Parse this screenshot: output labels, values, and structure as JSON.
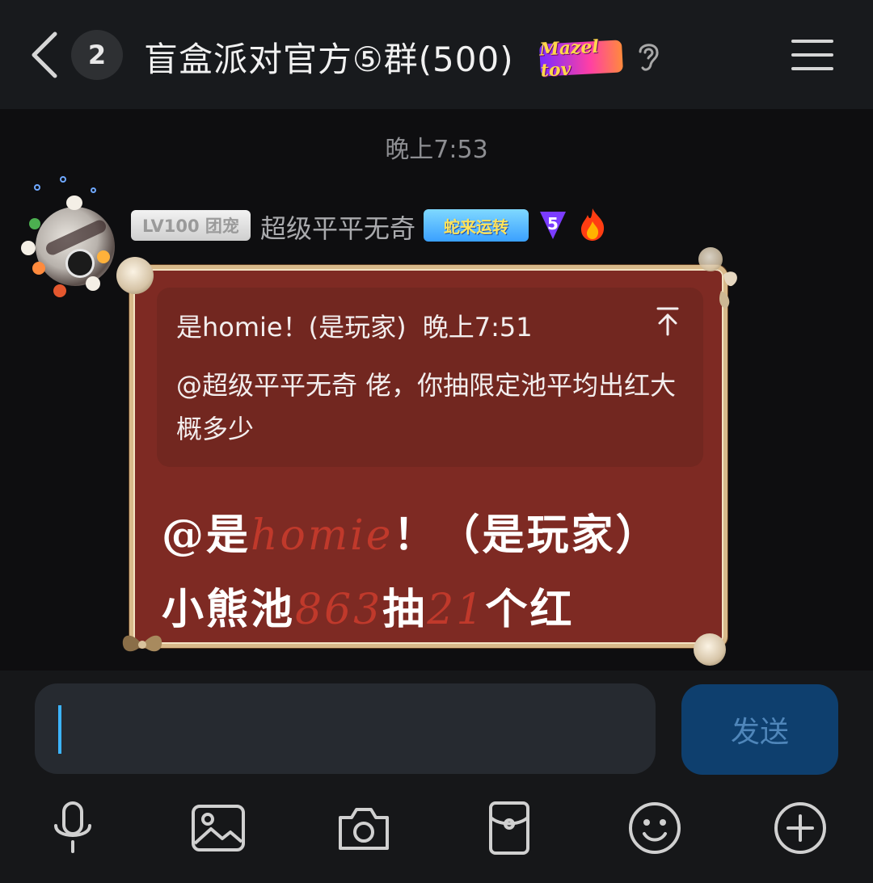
{
  "header": {
    "unread_count": "2",
    "group_title": "盲盒派对官方⑤群(500)",
    "tag_badge": "Mazel tov"
  },
  "time_divider": "晚上7:53",
  "message": {
    "level_badge": "LV100 团宠",
    "sender_name": "超级平平无奇",
    "title_badge": "蛇来运转",
    "quote": {
      "author": "是homie！(是玩家)",
      "time": "晚上7:51",
      "text": "@超级平平无奇 佬，你抽限定池平均出红大概多少"
    },
    "reply": {
      "line1_prefix": "@是",
      "line1_highlight": "homie",
      "line1_suffix": "！（是玩家）",
      "line2_a": "小熊池",
      "line2_num1": "863",
      "line2_b": "抽",
      "line2_num2": "21",
      "line2_c": "个红"
    }
  },
  "input": {
    "value": "",
    "send_label": "发送"
  },
  "toolbar": [
    "mic-icon",
    "image-icon",
    "camera-icon",
    "wallet-icon",
    "emoji-icon",
    "plus-icon"
  ],
  "colors": {
    "bubble": "#7e2a23",
    "bubble_border": "#d8b98a",
    "send_button": "#0e3f6e",
    "highlight": "#c0392b"
  }
}
